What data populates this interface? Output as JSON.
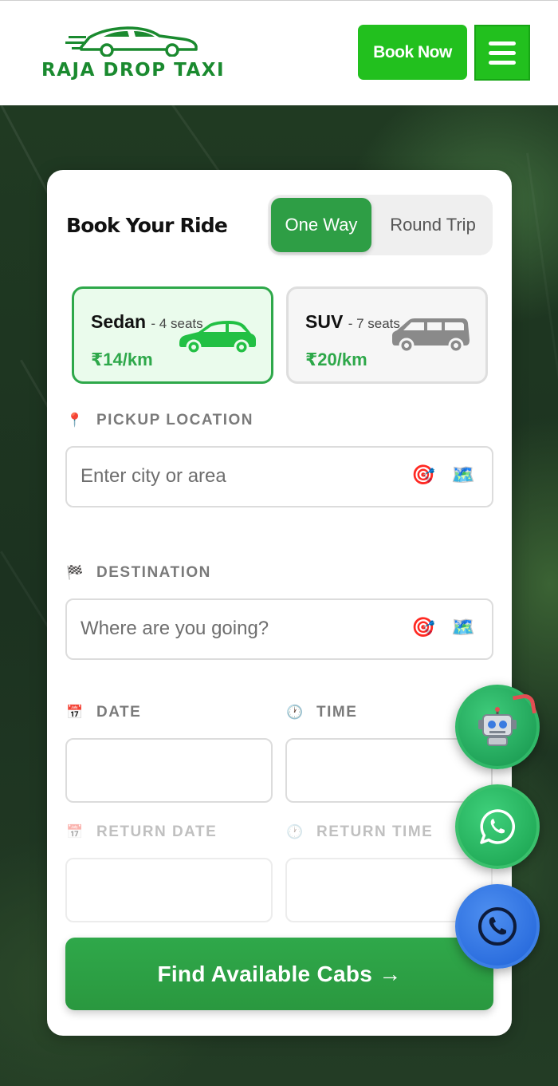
{
  "header": {
    "logo_text": "RAJA DROP TAXI",
    "book_now_label": "Book Now",
    "brand_color": "#22c01e"
  },
  "booking": {
    "title": "Book Your Ride",
    "trip_types": [
      "One Way",
      "Round Trip"
    ],
    "selected_trip_type": "One Way",
    "vehicles": [
      {
        "name": "Sedan",
        "seats": "- 4 seats",
        "price": "₹14/km",
        "selected": true
      },
      {
        "name": "SUV",
        "seats": "- 7 seats",
        "price": "₹20/km",
        "selected": false
      }
    ],
    "pickup": {
      "label": "PICKUP LOCATION",
      "placeholder": "Enter city or area",
      "icon": "pin-icon"
    },
    "destination": {
      "label": "DESTINATION",
      "placeholder": "Where are you going?",
      "icon": "checkered-flag-icon"
    },
    "date": {
      "label": "DATE",
      "value": "",
      "icon": "calendar-icon"
    },
    "time": {
      "label": "TIME",
      "value": "",
      "icon": "clock-icon"
    },
    "return_date": {
      "label": "RETURN DATE",
      "value": "",
      "icon": "calendar-icon"
    },
    "return_time": {
      "label": "RETURN TIME",
      "value": "",
      "icon": "clock-icon"
    },
    "submit_label": "Find Available Cabs →",
    "accent_color": "#2ea84a"
  },
  "floating_buttons": [
    {
      "name": "chatbot",
      "icon": "robot-icon",
      "color": "#15944c"
    },
    {
      "name": "whatsapp",
      "icon": "whatsapp-icon",
      "color": "#18a04d"
    },
    {
      "name": "call",
      "icon": "phone-icon",
      "color": "#1f62d8"
    }
  ]
}
